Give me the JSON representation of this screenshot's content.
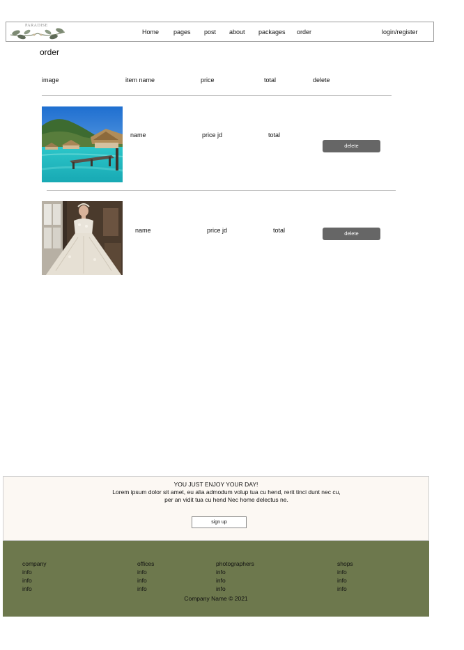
{
  "brand": {
    "logo_text": "PARADISE"
  },
  "nav": {
    "home": "Home",
    "pages": "pages",
    "post": "post",
    "about": "about",
    "packages": "packages",
    "order": "order",
    "login": "login/register"
  },
  "page_title": "order",
  "table": {
    "headers": {
      "image": "image",
      "item_name": "item name",
      "price": "price",
      "total": "total",
      "delete": "delete"
    },
    "rows": [
      {
        "image": "overwater-bungalows-photo",
        "name": "name",
        "price": "price jd",
        "total": "total",
        "delete_label": "delete"
      },
      {
        "image": "wedding-dress-photo",
        "name": "name",
        "price": "price jd",
        "total": "total",
        "delete_label": "delete"
      }
    ]
  },
  "promo": {
    "title": "YOU JUST ENJOY YOUR DAY!",
    "text": "Lorem ipsum dolor sit amet, eu alia admodum volup tua cu hend, rerit tinci dunt nec cu, per an vidit tua cu hend Nec home delectus ne.",
    "signup_label": "sign up"
  },
  "footer": {
    "columns": [
      {
        "title": "company",
        "items": [
          "info",
          "info",
          "info"
        ]
      },
      {
        "title": "offices",
        "items": [
          "info",
          "info",
          "info"
        ]
      },
      {
        "title": "photographers",
        "items": [
          "info",
          "info",
          "info"
        ]
      },
      {
        "title": "shops",
        "items": [
          "info",
          "info",
          "info"
        ]
      }
    ],
    "copyright": "Company Name © 2021"
  },
  "colors": {
    "footer_bg": "#6d784d",
    "promo_bg": "#fcf8f3",
    "button_bg": "#666666"
  }
}
